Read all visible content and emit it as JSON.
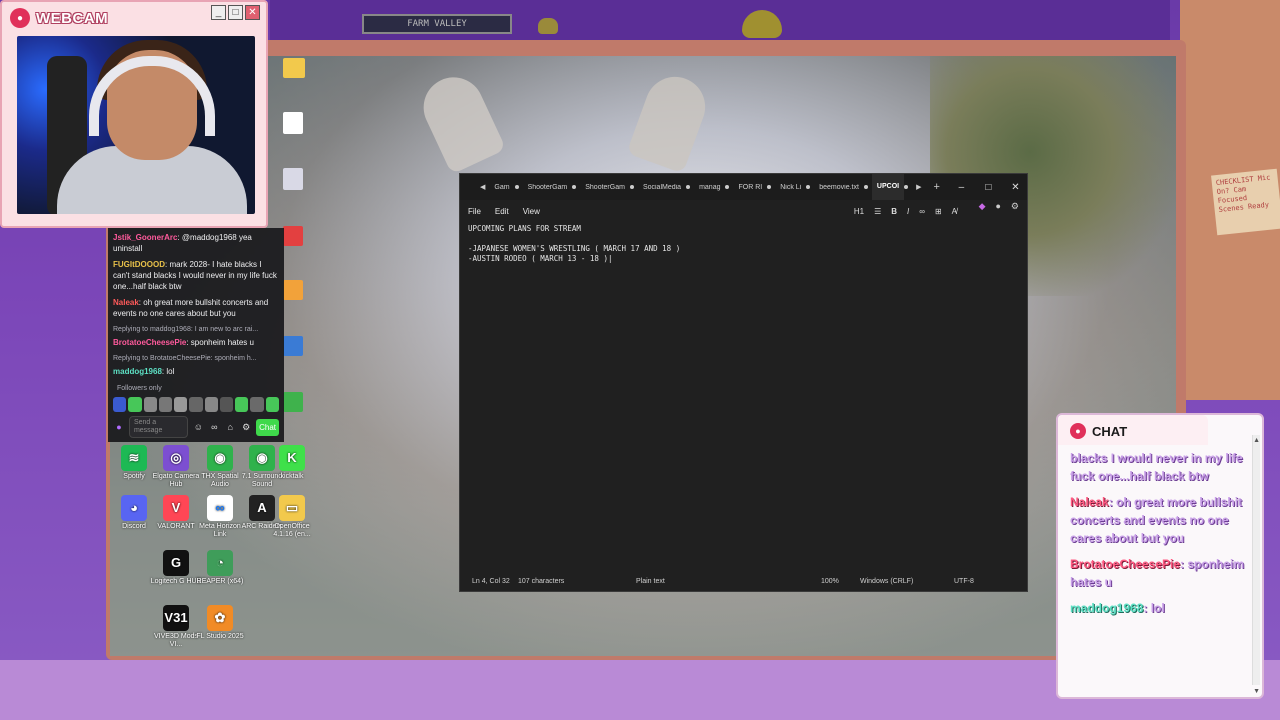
{
  "webcam": {
    "title": "WEBCAM"
  },
  "desktop_icons": [
    {
      "label": "Spotify",
      "color": "#1db954",
      "glyph": "≋"
    },
    {
      "label": "Elgato Camera Hub",
      "color": "#7c4fd1",
      "glyph": "◎"
    },
    {
      "label": "THX Spatial Audio",
      "color": "#2fb24c",
      "glyph": "◉"
    },
    {
      "label": "7.1 Surround Sound",
      "color": "#2fb24c",
      "glyph": "◉"
    },
    {
      "label": "kicktalk",
      "color": "#3fe04a",
      "glyph": "K"
    },
    {
      "label": "Discord",
      "color": "#5865f2",
      "glyph": "◕"
    },
    {
      "label": "VALORANT",
      "color": "#ff4655",
      "glyph": "V"
    },
    {
      "label": "Meta Horizon Link",
      "color": "#ffffff",
      "glyph": "∞"
    },
    {
      "label": "ARC Raiders",
      "color": "#222222",
      "glyph": "A"
    },
    {
      "label": "OpenOffice 4.1.16 (en...",
      "color": "#f2c94c",
      "glyph": "▭"
    },
    {
      "label": "Logitech G HUB",
      "color": "#111111",
      "glyph": "G"
    },
    {
      "label": "REAPER (x64)",
      "color": "#3f9d5a",
      "glyph": "◔"
    },
    {
      "label": "VIVE3D Mods VI...",
      "color": "#111111",
      "glyph": "V31"
    },
    {
      "label": "FL Studio 2025",
      "color": "#f18b26",
      "glyph": "✿"
    }
  ],
  "side_chat": {
    "messages": [
      {
        "user": "Jstik_GoonerArc",
        "user_color": "#ff5a9c",
        "text": ": @maddog1968 yea uninstall"
      },
      {
        "user": "FUGItDOOOD",
        "user_color": "#e8c14a",
        "text": ": mark 2028- I hate blacks I can't stand blacks I would never in my life fuck one...half black btw"
      },
      {
        "user": "Naleak",
        "user_color": "#ff5a5a",
        "text": ": oh great more bullshit concerts and events no one cares about but you"
      }
    ],
    "reply_1": "Replying to maddog1968: I am new to arc rai...",
    "reply_1_user": "BrotatoeCheesePie",
    "reply_1_text": ": sponheim hates u",
    "reply_2": "Replying to BrotatoeCheesePie: sponheim h...",
    "reply_2_user": "maddog1968",
    "reply_2_text": ": lol",
    "followers_only": "Followers only",
    "input_placeholder": "Send a message",
    "send_label": "Chat"
  },
  "notepad": {
    "tabs": [
      "Gam",
      "ShooterGam",
      "ShooterGam",
      "SocialMedia",
      "manag",
      "FOR RI",
      "Nick Li",
      "beemovie.txt",
      "UPCOI"
    ],
    "menu": {
      "file": "File",
      "edit": "Edit",
      "view": "View"
    },
    "toolbar": {
      "heading": "H1",
      "bold": "B",
      "italic": "I"
    },
    "content": "UPCOMING PLANS FOR STREAM\n\n-JAPANESE WOMEN'S WRESTLING ( MARCH 17 AND 18 )\n-AUSTIN RODEO ( MARCH 13 - 18 )|",
    "status": {
      "position": "Ln 4, Col 32",
      "characters": "107 characters",
      "format": "Plain text",
      "zoom": "100%",
      "line_ending": "Windows (CRLF)",
      "encoding": "UTF-8"
    }
  },
  "chat_overlay": {
    "title": "CHAT",
    "msg1_text": "blacks I would never in my life fuck one...half black btw",
    "msg2_user": "Naleak",
    "msg2_text": ": oh great more bullshit concerts and events no one cares about but you",
    "msg3_user": "BrotatoeCheesePie",
    "msg3_text": ": sponheim hates u",
    "msg4_user": "maddog1968",
    "msg4_text": ": lol"
  },
  "room": {
    "shelf_sign": "FARM VALLEY",
    "checklist": "CHECKLIST Mic On? Cam Focused Scenes Ready"
  }
}
